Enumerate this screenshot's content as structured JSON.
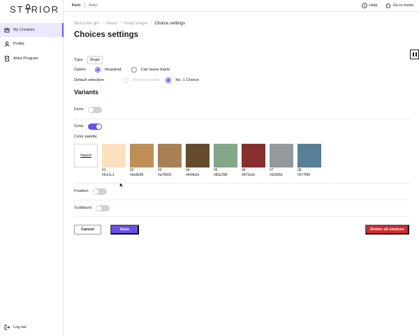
{
  "app": {
    "logo_text_left": "ST",
    "logo_text_right": "RIOR"
  },
  "sidebar": {
    "items": [
      {
        "label": "My Creators",
        "icon": "creators-icon",
        "active": true
      },
      {
        "label": "Profile",
        "icon": "person-icon",
        "active": false
      },
      {
        "label": "Artist Program",
        "icon": "document-icon",
        "active": false
      }
    ],
    "logout_label": "Log out"
  },
  "topbar": {
    "user_name": "Fern",
    "user_role": "Artist",
    "help_label": "Help",
    "home_label": "Go to home"
  },
  "breadcrumb": {
    "items": [
      "Muscular girl",
      "Head",
      "Head shape"
    ],
    "current": "Choice settings",
    "separator": "/"
  },
  "page": {
    "title": "Choices settings"
  },
  "settings": {
    "type_label": "Type",
    "type_value": "Single",
    "option_label": "Option",
    "option_choices": [
      {
        "label": "Required",
        "checked": true,
        "disabled": false
      },
      {
        "label": "Can leave blank",
        "checked": false,
        "disabled": false
      }
    ],
    "default_label": "Default selection",
    "default_choices": [
      {
        "label": "Remove button",
        "checked": false,
        "disabled": true
      },
      {
        "label": "No. 1 Choice",
        "checked": true,
        "disabled": false
      }
    ]
  },
  "variants": {
    "title": "Variants",
    "form_label": "Form",
    "form_on": false,
    "color_label": "Color",
    "color_on": true,
    "palette_label": "Color palette",
    "import_label": "Import",
    "swatches": [
      {
        "num": "01",
        "hex": "#fce1c1",
        "color": "#fce1c1"
      },
      {
        "num": "02",
        "hex": "#be8e56",
        "color": "#be8e56"
      },
      {
        "num": "03",
        "hex": "#a78053",
        "color": "#a78053"
      },
      {
        "num": "04",
        "hex": "#644b2e",
        "color": "#644b2e"
      },
      {
        "num": "05",
        "hex": "#83a788",
        "color": "#83a788"
      },
      {
        "num": "06",
        "hex": "#872e2e",
        "color": "#872e2e"
      },
      {
        "num": "07",
        "hex": "#93999c",
        "color": "#93999c"
      },
      {
        "num": "08",
        "hex": "#577f96",
        "color": "#577f96"
      }
    ],
    "position_label": "Position",
    "position_on": false,
    "scabbard_label": "Scabbard",
    "scabbard_on": false
  },
  "actions": {
    "cancel_label": "Cancel",
    "save_label": "Save",
    "delete_label": "Delete all choices"
  },
  "colors": {
    "accent": "#6c4ff0",
    "danger": "#d8282b",
    "active_bg": "#ece8ff"
  }
}
